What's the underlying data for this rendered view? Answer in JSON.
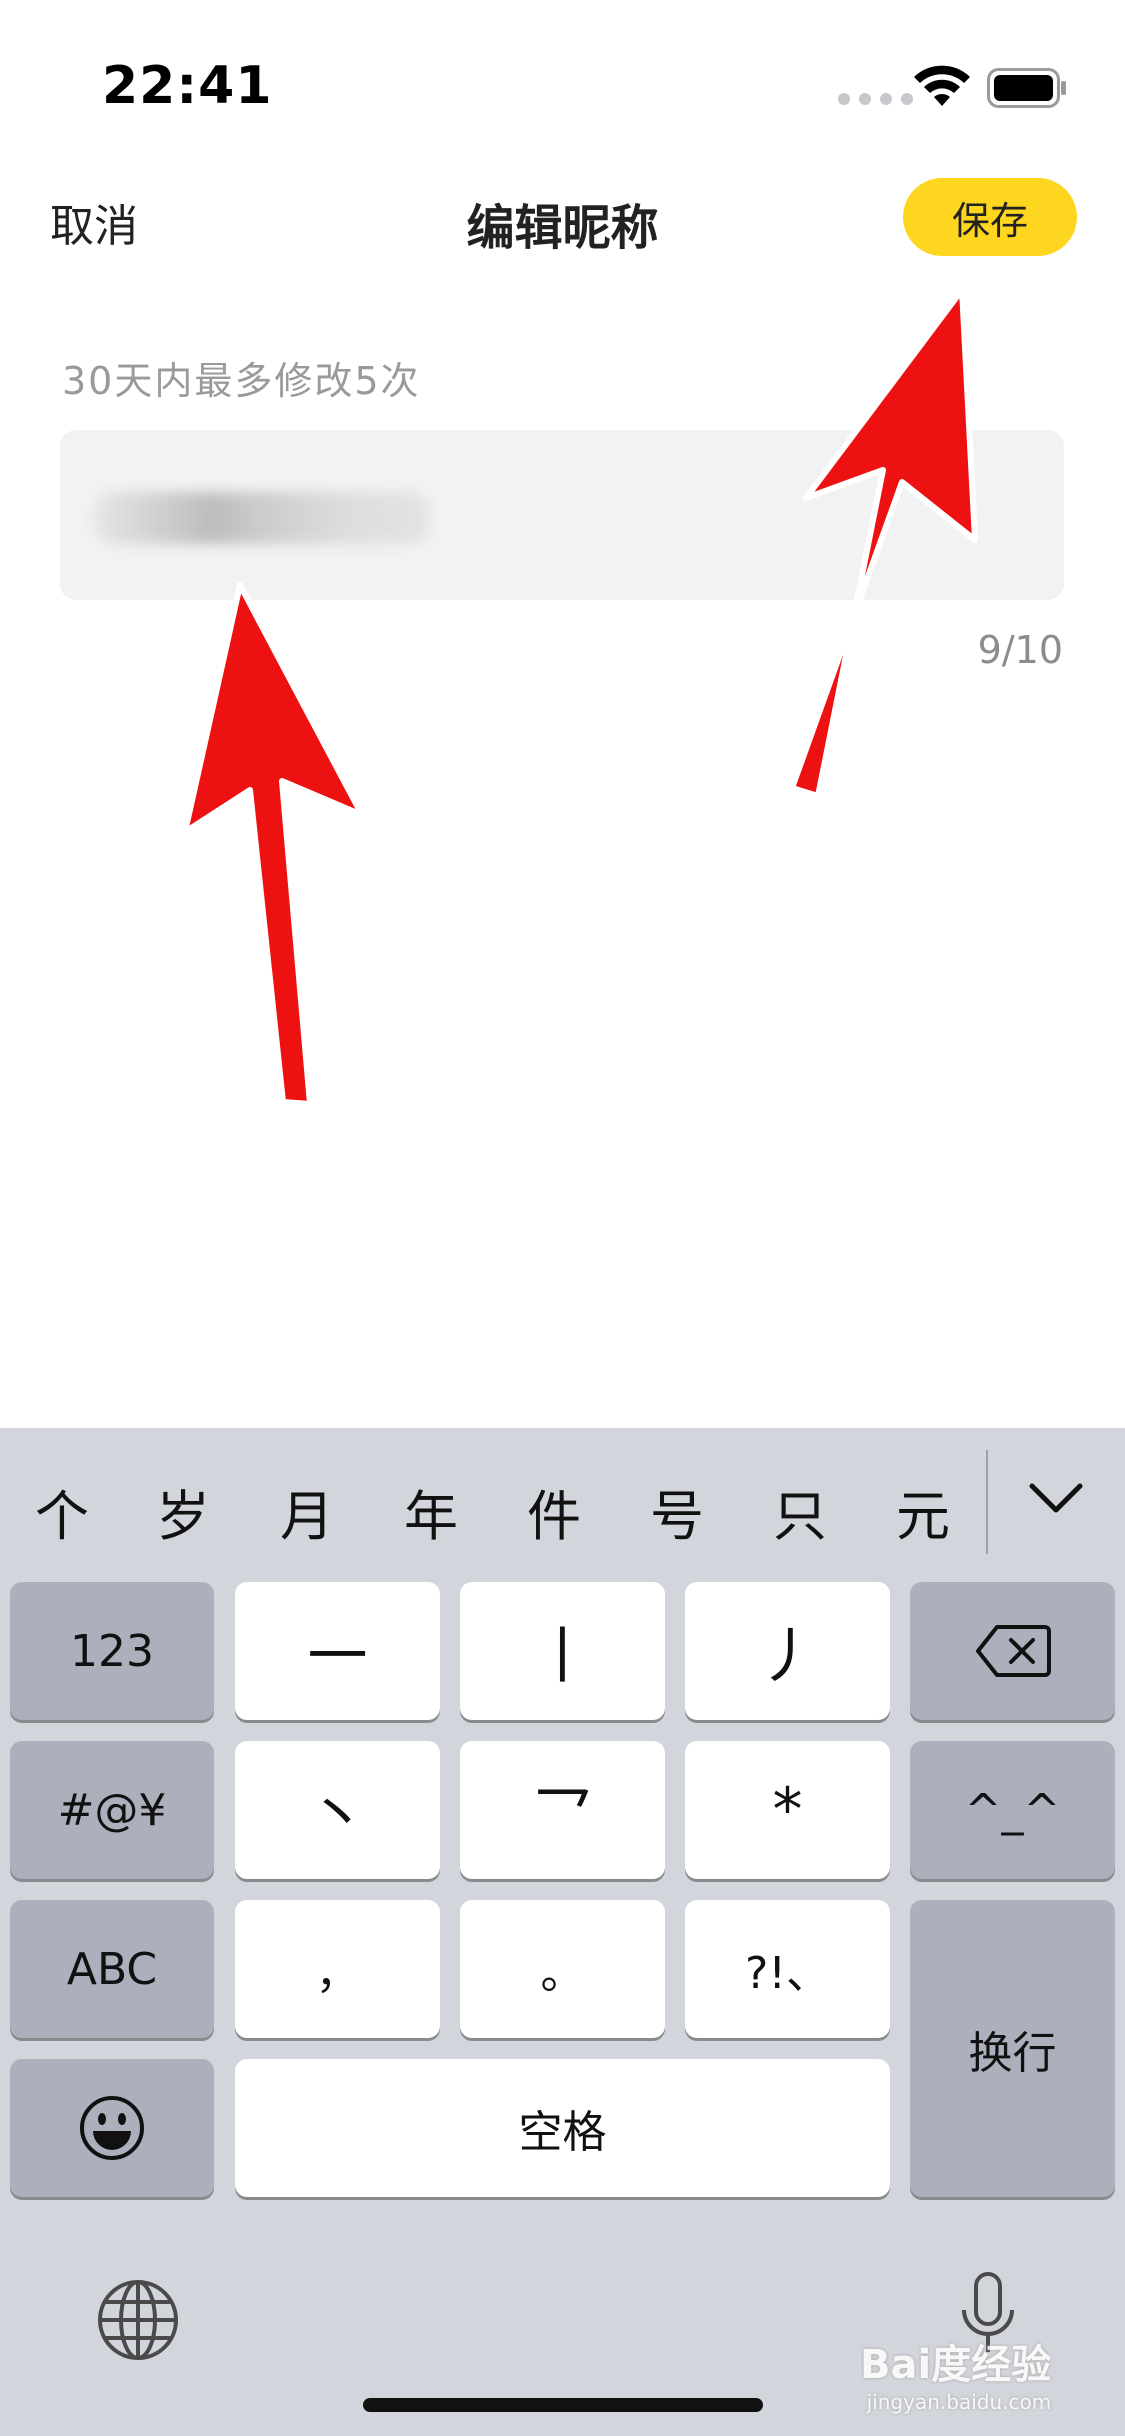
{
  "status_bar": {
    "time": "22:41"
  },
  "nav": {
    "cancel_label": "取消",
    "title": "编辑昵称",
    "save_label": "保存",
    "save_color": "#ffd61f"
  },
  "form": {
    "hint": "30天内最多修改5次",
    "counter": "9/10"
  },
  "keyboard": {
    "candidates": [
      "个",
      "岁",
      "月",
      "年",
      "件",
      "号",
      "只",
      "元"
    ],
    "keys": {
      "num": "123",
      "symbols": "#@¥",
      "abc": "ABC",
      "stroke_h": "一",
      "stroke_s": "丨",
      "stroke_p": "丿",
      "stroke_d": "丶",
      "stroke_z": "乛",
      "star": "*",
      "emoticon": "^_^",
      "comma": "，",
      "period": "。",
      "punct": "?!、",
      "space": "空格",
      "return": "换行"
    }
  },
  "watermark": {
    "brand": "Bai度经验",
    "url": "jingyan.baidu.com"
  },
  "annotation_color": "#ee1111"
}
